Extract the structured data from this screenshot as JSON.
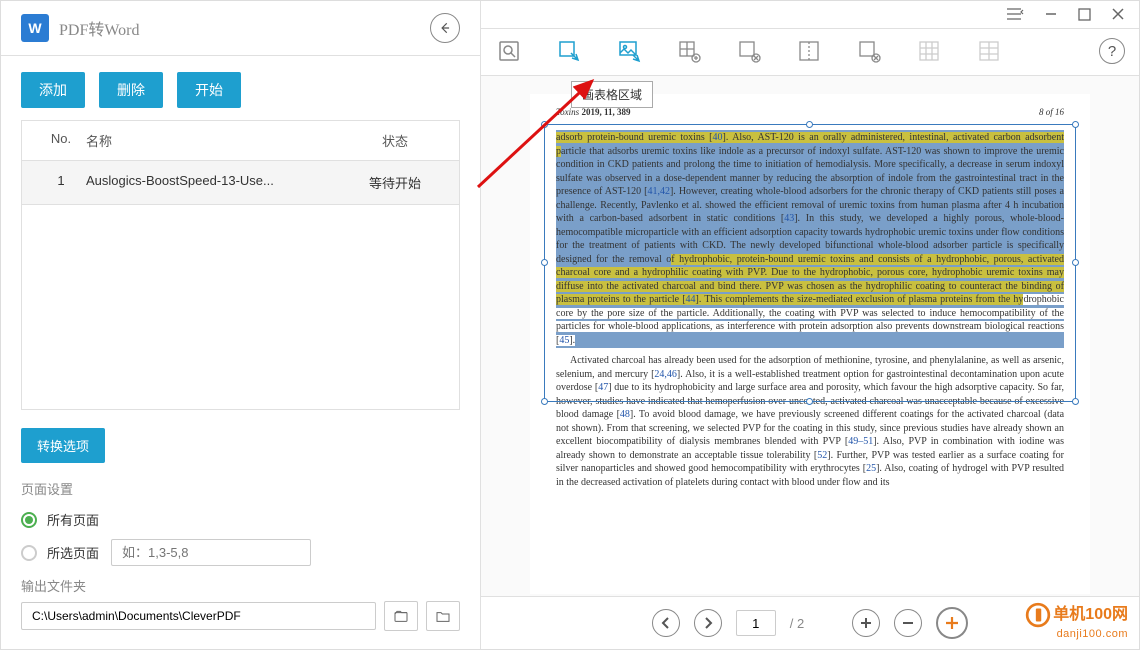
{
  "left": {
    "title": "PDF转Word",
    "word_glyph": "W",
    "buttons": {
      "add": "添加",
      "delete": "删除",
      "start": "开始"
    },
    "columns": {
      "no": "No.",
      "name": "名称",
      "status": "状态"
    },
    "files": [
      {
        "no": "1",
        "name": "Auslogics-BoostSpeed-13-Use...",
        "status": "等待开始"
      }
    ],
    "convert_options": "转换选项",
    "page_settings_label": "页面设置",
    "all_pages": "所有页面",
    "selected_pages": "所选页面",
    "page_placeholder": "如：1,3-5,8",
    "output_label": "输出文件夹",
    "output_path": "C:\\Users\\admin\\Documents\\CleverPDF"
  },
  "toolbar": {
    "tooltip": "画表格区域",
    "help_glyph": "?"
  },
  "doc": {
    "journal_prefix": "Toxins ",
    "journal_year_vol": "2019, 11, 389",
    "page_of": "8 of 16",
    "p1a": "adsorb protein-bound uremic toxins [",
    "r40": "40",
    "p1b": "]. Also, AST-120 is an orally administered, intestinal, activated carbon adsorbent p",
    "p1c": "article that adsorbs uremic toxins like indole as a precursor of indoxyl sulfate. AST-120 was shown to improve the uremic condition in CKD patients and prolong the time to initiation of hemodialysis. More specifically, a decrease in serum indoxyl sulfate was observed in a dose-dependent manner by reducing the absorption of indole from the gastrointestinal tract in the presence of AST-120 [",
    "r4142": "41,42",
    "p1d": "]. However, creating whole-blood adsorbers for the chronic therapy of CKD patients still poses a challenge. Recently, Pavlenko et al. showed the efficient removal of uremic toxins from human plasma after 4 h incubation with a carbon-based adsorbent in static conditions [",
    "r43": "43",
    "p1e": "]. In this study, we developed a highly porous, whole-blood-hemocompatible microparticle with an efficient adsorption capacity towards hydrophobic uremic toxins under flow conditions for the treatment of patients with CKD. The newly developed bifunctional whole-blood adsorber particle is specifically designed for the removal o",
    "p1f": "f hydrophobic, protein-bound uremic toxins and consists of a hydrophobic, porous, activated charcoal core and a hydrophilic coating with PVP. Due to the hydrophobic, porous core, hydrophobic uremic toxins may diffuse into the activated charcoal and bind there. PVP was chosen as the hydrophilic coating to counteract the binding of plasma proteins to the particle [",
    "r44": "44",
    "p1g": "]. This complements the size-mediated exclusion of plasma proteins from the hy",
    "p1h": "drophobic core by the pore size of the particle. Additionally, the coating with PVP was selected to induce hemocompatibility of the particles for whole-blood applications, as interference with protein adsorption also prevents downstream biological reactions [",
    "r45": "45",
    "p1i": "].",
    "p2a": "Activated charcoal has already been used for the adsorption of methionine, tyrosine, and phenylalanine, as well as arsenic, selenium, and mercury [",
    "r2446": "24,46",
    "p2b": "]. Also, it is a well-established treatment option for gastrointestinal decontamination upon acute overdose [",
    "r47": "47",
    "p2c": "] due to its hydrophobicity and large surface area and porosity, which favour the high adsorptive capacity. So far, however, studies have indicated that hemoperfusion over uncoated, activated charcoal was unacceptable because of excessive blood damage [",
    "r48": "48",
    "p2d": "]. To avoid blood damage, we have previously screened different coatings for the activated charcoal (data not shown). From that screening, we selected PVP for the coating in this study, since previous studies have already shown an excellent biocompatibility of dialysis membranes blended with PVP [",
    "r4951": "49–51",
    "p2e": "]. Also, PVP in combination with iodine was already shown to demonstrate an acceptable tissue tolerability [",
    "r52": "52",
    "p2f": "]. Further, PVP was tested earlier as a surface coating for silver nanoparticles and showed good hemocompatibility with erythrocytes [",
    "r25": "25",
    "p2g": "]. Also, coating of hydrogel with PVP resulted in the decreased activation of platelets during contact with blood under flow and its"
  },
  "pager": {
    "current": "1",
    "sep": "/",
    "total": "2"
  },
  "watermark": {
    "top": "单机100网",
    "bottom": "danji100.com"
  }
}
